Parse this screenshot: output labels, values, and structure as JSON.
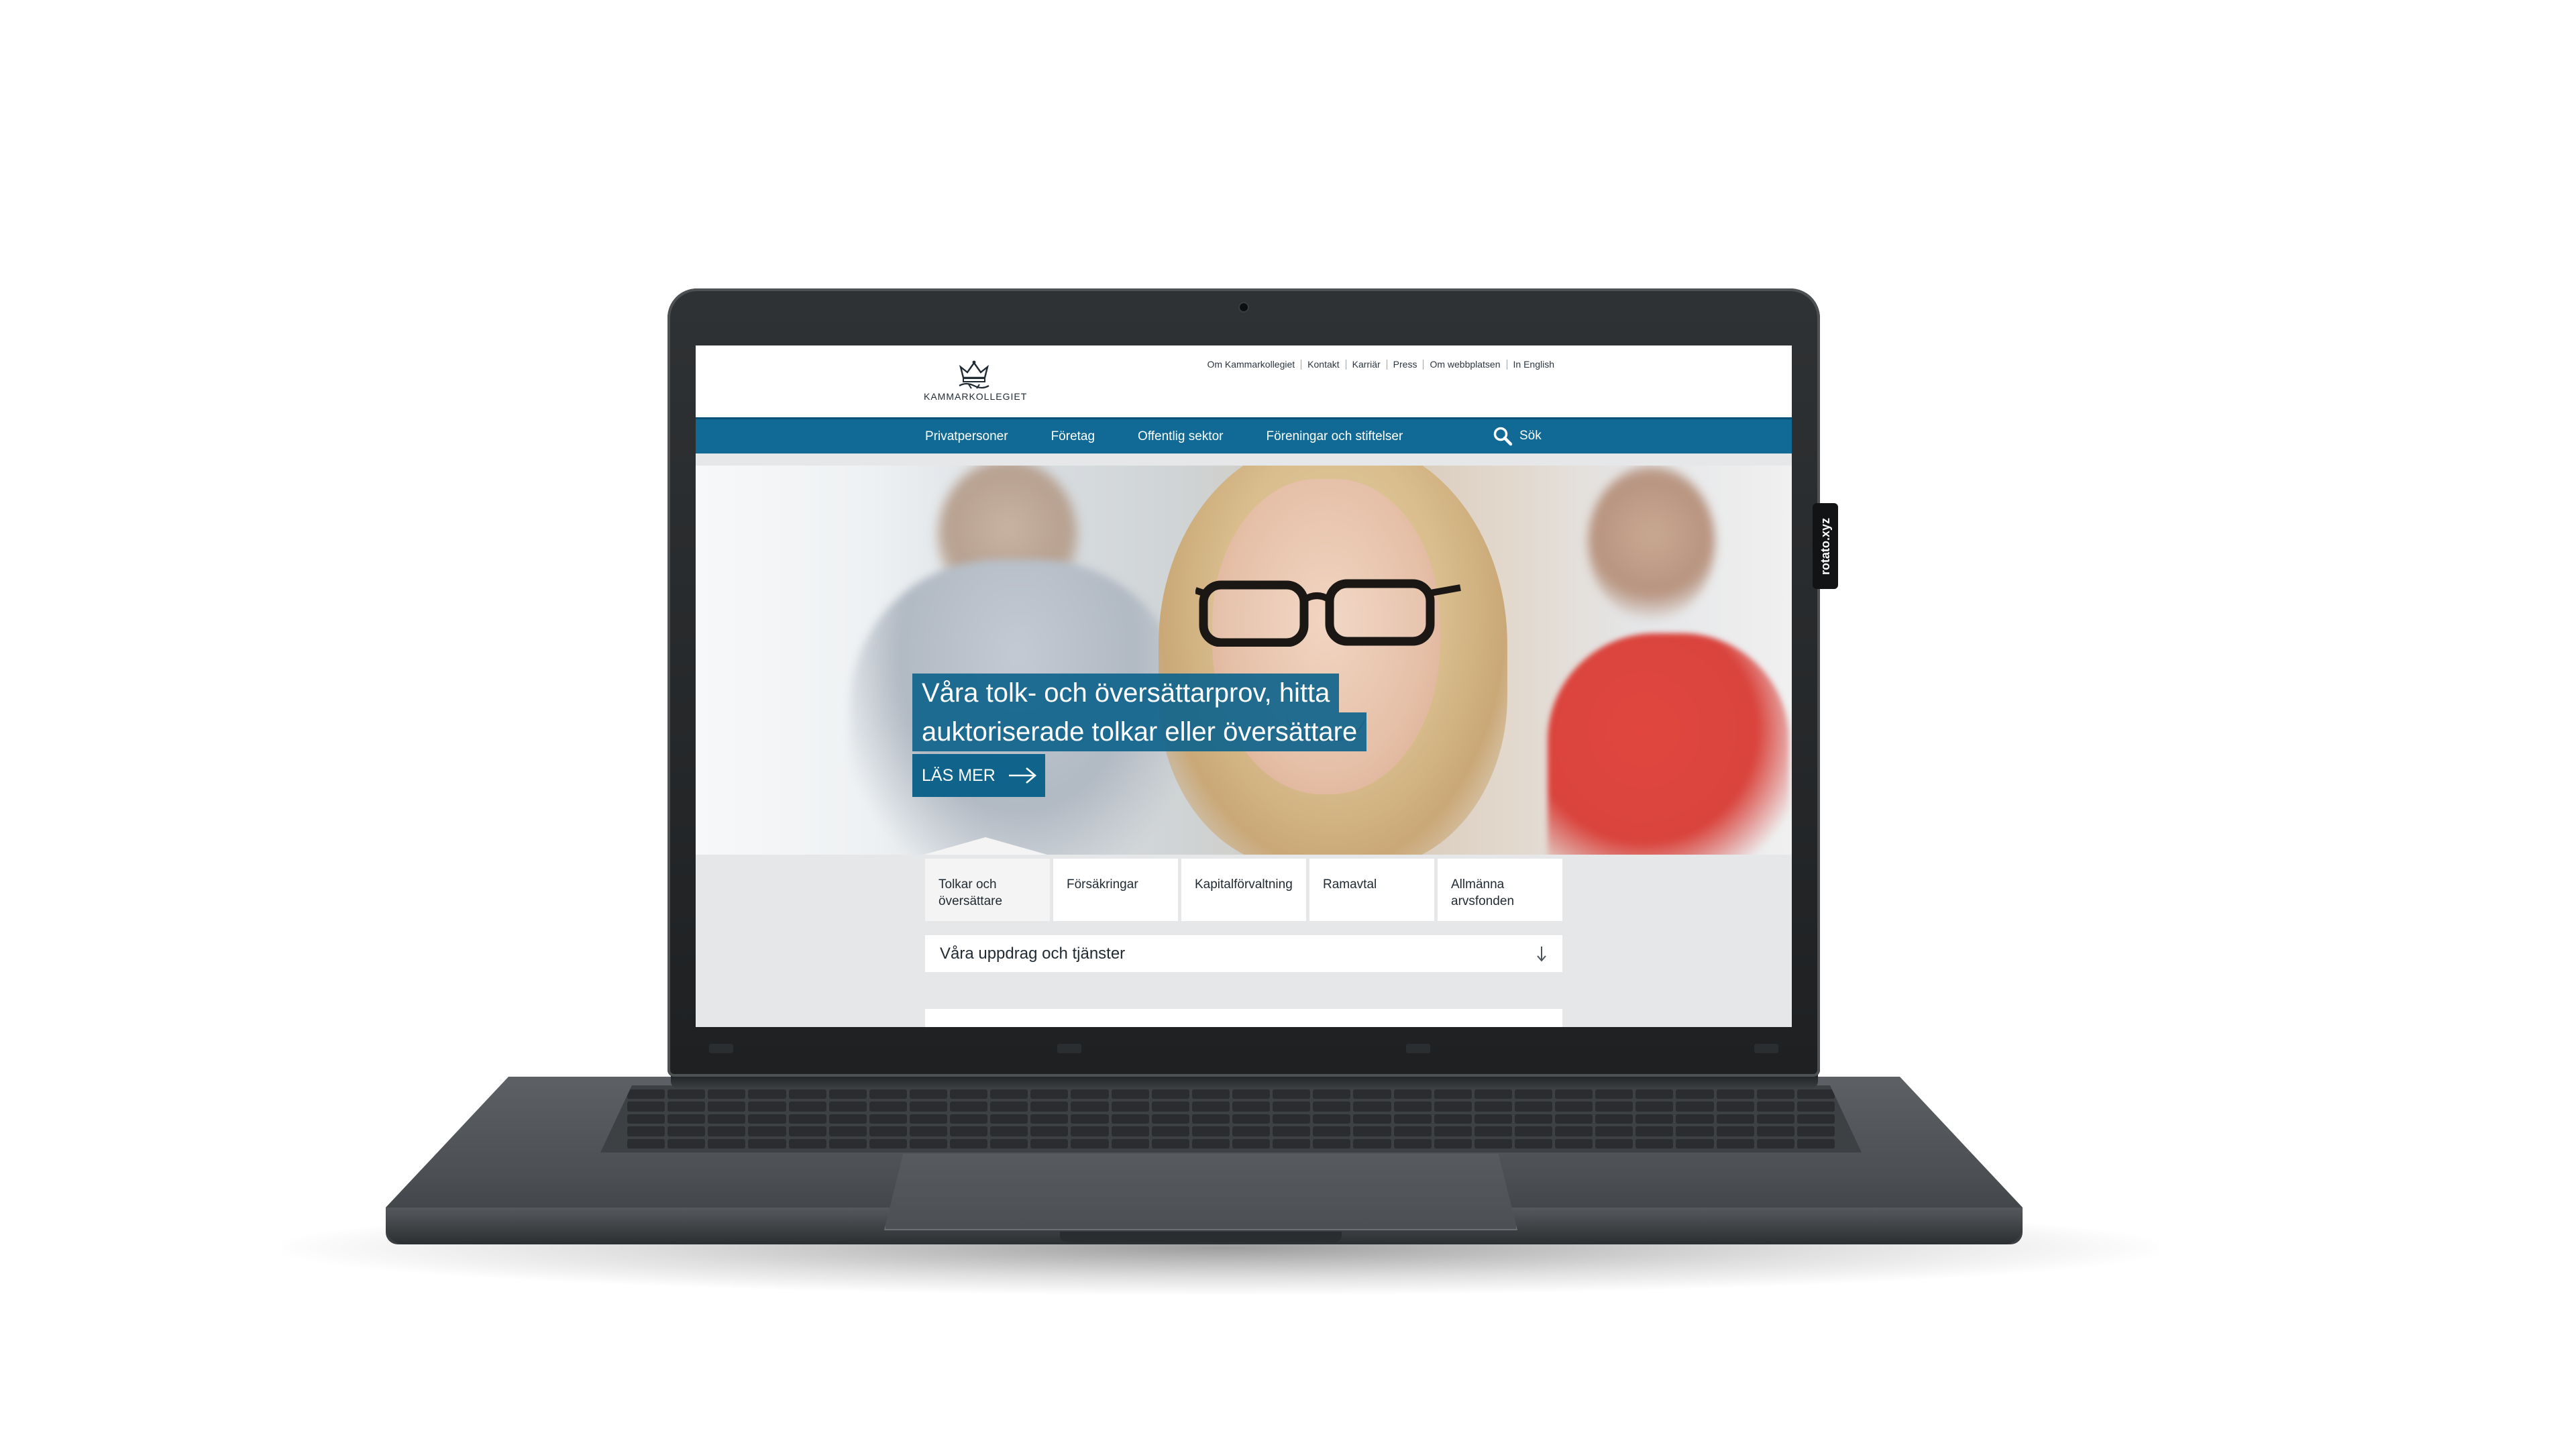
{
  "header": {
    "logo_text": "KAMMARKOLLEGIET",
    "top_links": [
      "Om Kammarkollegiet",
      "Kontakt",
      "Karriär",
      "Press",
      "Om webbplatsen",
      "In English"
    ]
  },
  "nav": {
    "items": [
      "Privatpersoner",
      "Företag",
      "Offentlig sektor",
      "Föreningar och stiftelser"
    ],
    "search_label": "Sök"
  },
  "hero": {
    "headline_line1": "Våra tolk- och översättarprov, hitta",
    "headline_line2": "auktoriserade tolkar eller översättare",
    "cta_label": "LÄS MER"
  },
  "tabs": [
    {
      "line1": "Tolkar och",
      "line2": "översättare"
    },
    {
      "line1": "Försäkringar",
      "line2": ""
    },
    {
      "line1": "Kapitalförvaltning",
      "line2": ""
    },
    {
      "line1": "Ramavtal",
      "line2": ""
    },
    {
      "line1": "Allmänna",
      "line2": "arvsfonden"
    }
  ],
  "dropdown": {
    "label": "Våra uppdrag och tjänster",
    "icon": "arrow-down-icon"
  },
  "device": {
    "sticker_text": "rotato.xyz"
  },
  "colors": {
    "brand_blue": "#106a95",
    "hero_box": "#10648c",
    "panel_gray": "#e6e7e8"
  }
}
